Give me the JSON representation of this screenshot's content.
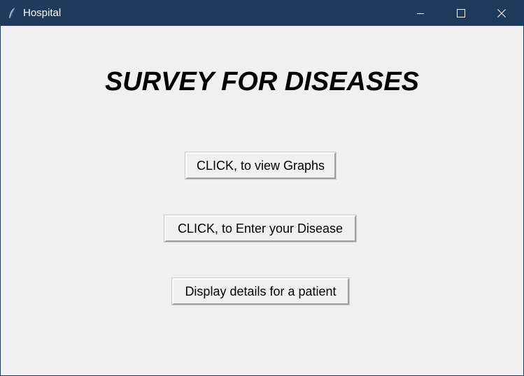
{
  "window": {
    "title": "Hospital",
    "titlebar_color": "#1f3a5c",
    "background_color": "#f0f0f0",
    "app_icon": "feather-icon",
    "controls": {
      "minimize_icon": "minimize-icon",
      "maximize_icon": "maximize-icon",
      "close_icon": "close-icon"
    }
  },
  "main": {
    "heading": "SURVEY FOR DISEASES",
    "buttons": {
      "view_graphs": "CLICK, to view Graphs",
      "enter_disease": "CLICK, to Enter your Disease",
      "patient_details": "Display details for a patient"
    }
  }
}
